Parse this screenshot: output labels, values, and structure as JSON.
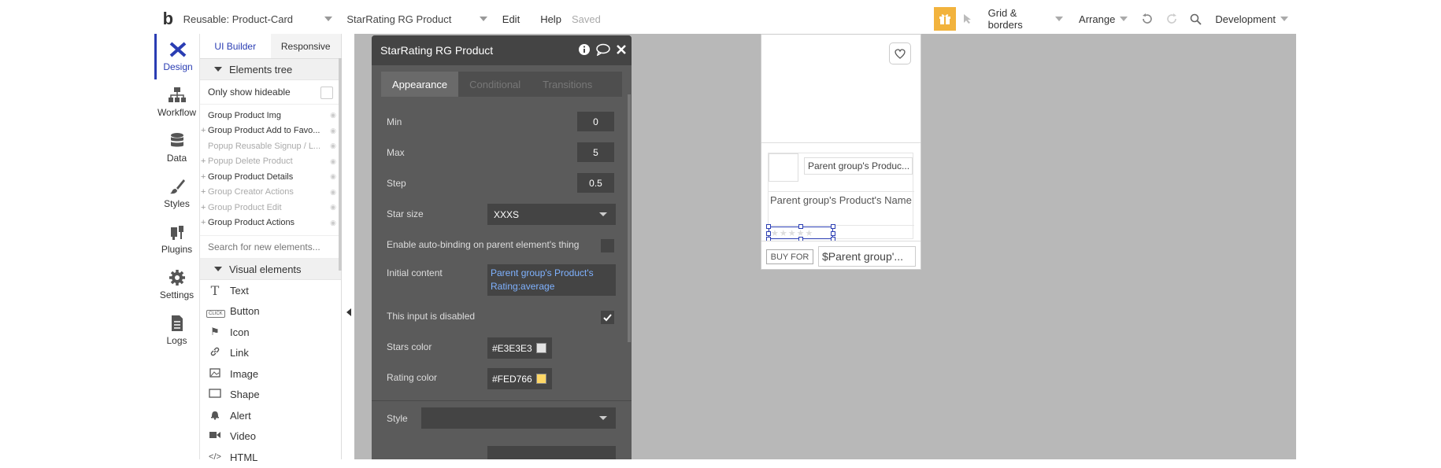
{
  "topbar": {
    "logo": "b",
    "page_select": "Reusable: Product-Card",
    "element_select": "StarRating RG Product",
    "menu_edit": "Edit",
    "menu_help": "Help",
    "status_saved": "Saved",
    "grid_borders": "Grid & borders",
    "arrange": "Arrange",
    "environment": "Development"
  },
  "leftnav": {
    "items": [
      {
        "label": "Design",
        "icon": "design-icon"
      },
      {
        "label": "Workflow",
        "icon": "workflow-icon"
      },
      {
        "label": "Data",
        "icon": "database-icon"
      },
      {
        "label": "Styles",
        "icon": "brush-icon"
      },
      {
        "label": "Plugins",
        "icon": "plug-icon"
      },
      {
        "label": "Settings",
        "icon": "gear-icon"
      },
      {
        "label": "Logs",
        "icon": "document-icon"
      }
    ]
  },
  "elements_panel": {
    "tab_ui_builder": "UI Builder",
    "tab_responsive": "Responsive",
    "elements_tree_label": "Elements tree",
    "only_show_hideable": "Only show hideable",
    "tree": [
      {
        "label": "Group Product Img",
        "dim": false,
        "plus": false
      },
      {
        "label": "Group Product Add to Favo...",
        "dim": false,
        "plus": true
      },
      {
        "label": "Popup Reusable Signup / L...",
        "dim": true,
        "plus": false
      },
      {
        "label": "Popup Delete Product",
        "dim": true,
        "plus": true
      },
      {
        "label": "Group Product Details",
        "dim": false,
        "plus": true
      },
      {
        "label": "Group Creator Actions",
        "dim": true,
        "plus": true
      },
      {
        "label": "Group Product Edit",
        "dim": true,
        "plus": true
      },
      {
        "label": "Group Product Actions",
        "dim": false,
        "plus": true
      }
    ],
    "search_placeholder": "Search for new elements...",
    "visual_elements_label": "Visual elements",
    "visual": [
      {
        "label": "Text",
        "icon": "T"
      },
      {
        "label": "Button",
        "icon": "CLICK"
      },
      {
        "label": "Icon",
        "icon": "⚑"
      },
      {
        "label": "Link",
        "icon": "🔗"
      },
      {
        "label": "Image",
        "icon": "▨"
      },
      {
        "label": "Shape",
        "icon": "▭"
      },
      {
        "label": "Alert",
        "icon": "🔔"
      },
      {
        "label": "Video",
        "icon": "▶"
      },
      {
        "label": "HTML",
        "icon": "</>"
      }
    ]
  },
  "props": {
    "title": "StarRating RG Product",
    "tab_appearance": "Appearance",
    "tab_conditional": "Conditional",
    "tab_transitions": "Transitions",
    "min_label": "Min",
    "min_value": "0",
    "max_label": "Max",
    "max_value": "5",
    "step_label": "Step",
    "step_value": "0.5",
    "star_size_label": "Star size",
    "star_size_value": "XXXS",
    "autobind_label": "Enable auto-binding on parent element's thing",
    "initial_content_label": "Initial content",
    "initial_content_value": "Parent group's Product's Rating:average",
    "disabled_label": "This input is disabled",
    "stars_color_label": "Stars color",
    "stars_color_value": "#E3E3E3",
    "rating_color_label": "Rating color",
    "rating_color_value": "#FED766",
    "style_label": "Style"
  },
  "card": {
    "creator_text": "Parent group's Produc...",
    "product_name": "Parent group's Product's Name",
    "stars": "★★★★★",
    "buy_label": "BUY FOR",
    "price": "$Parent group'..."
  },
  "colors": {
    "accent": "#2a3db3",
    "gift": "#f2b33d",
    "stars": "#E3E3E3",
    "rating": "#FED766"
  }
}
